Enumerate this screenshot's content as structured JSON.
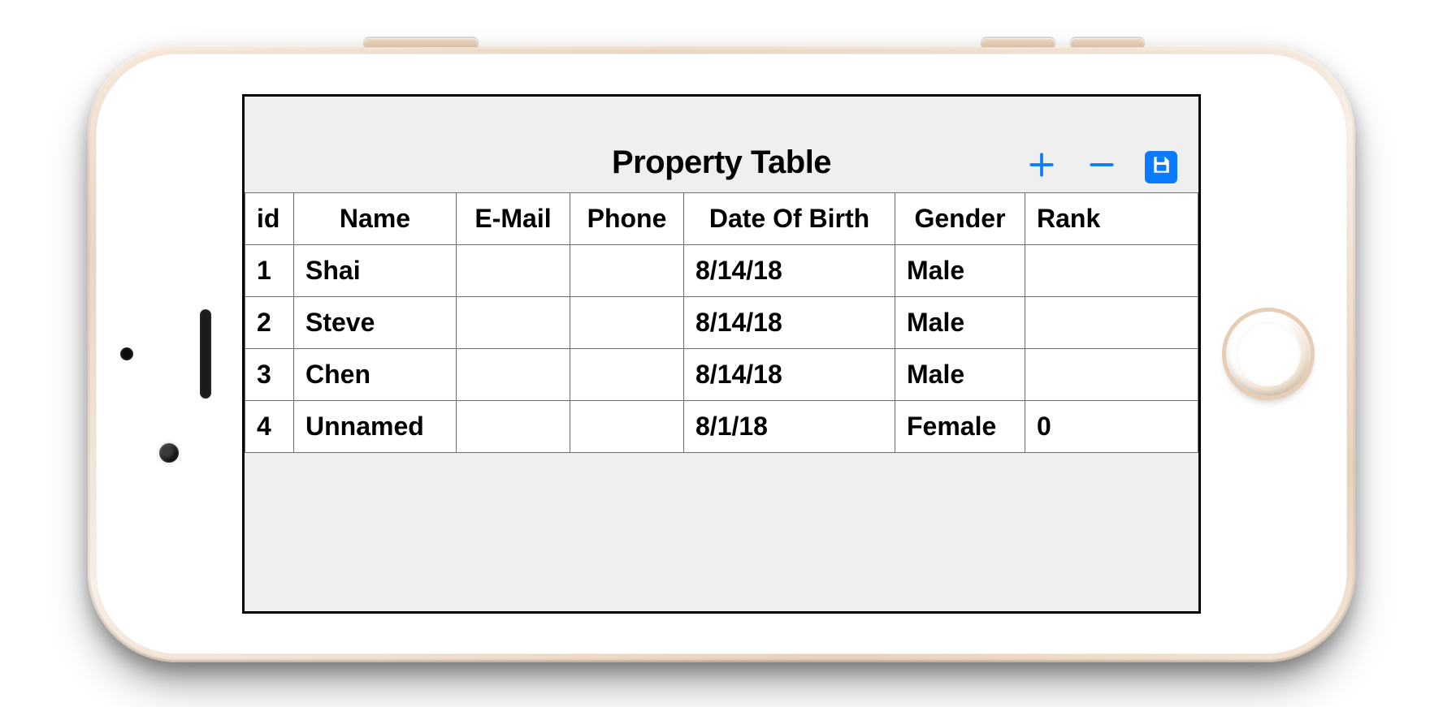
{
  "colors": {
    "accent": "#0a7aff"
  },
  "header": {
    "title": "Property Table"
  },
  "actions": {
    "add": {
      "name": "add-button",
      "icon": "plus-icon"
    },
    "remove": {
      "name": "remove-button",
      "icon": "minus-icon"
    },
    "save": {
      "name": "save-button",
      "icon": "save-icon"
    }
  },
  "table": {
    "columns": [
      {
        "key": "id",
        "label": "id"
      },
      {
        "key": "name",
        "label": "Name"
      },
      {
        "key": "email",
        "label": "E-Mail"
      },
      {
        "key": "phone",
        "label": "Phone"
      },
      {
        "key": "dob",
        "label": "Date Of Birth"
      },
      {
        "key": "gender",
        "label": "Gender"
      },
      {
        "key": "rank",
        "label": "Rank"
      }
    ],
    "rows": [
      {
        "id": "1",
        "name": "Shai",
        "email": "",
        "phone": "",
        "dob": "8/14/18",
        "gender": "Male",
        "rank": ""
      },
      {
        "id": "2",
        "name": "Steve",
        "email": "",
        "phone": "",
        "dob": "8/14/18",
        "gender": "Male",
        "rank": ""
      },
      {
        "id": "3",
        "name": "Chen",
        "email": "",
        "phone": "",
        "dob": "8/14/18",
        "gender": "Male",
        "rank": ""
      },
      {
        "id": "4",
        "name": "Unnamed",
        "email": "",
        "phone": "",
        "dob": "8/1/18",
        "gender": "Female",
        "rank": "0"
      }
    ]
  }
}
